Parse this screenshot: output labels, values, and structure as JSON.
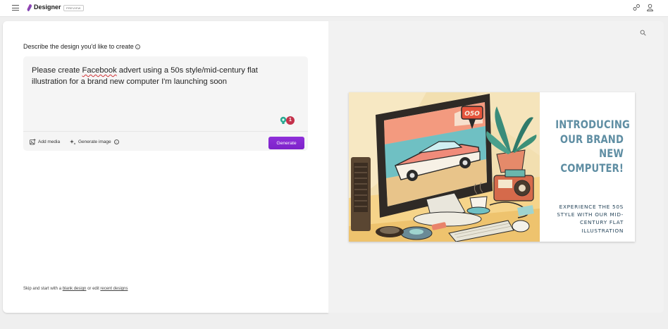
{
  "app": {
    "title": "Designer",
    "badge": "PREVIEW"
  },
  "left": {
    "heading": "Describe the design you'd like to create",
    "prompt_before": "Please create ",
    "prompt_flagged_word": "Facebook",
    "prompt_after": " advert using a 50s style/mid-century flat illustration for a brand new computer I'm launching soon",
    "issue_count": "1",
    "add_media_label": "Add media",
    "generate_image_label": "Generate image",
    "generate_button": "Generate",
    "footer": {
      "prefix": "Skip and start with a ",
      "blank_link": "blank design",
      "middle": " or edit ",
      "recent_link": "recent designs"
    }
  },
  "preview": {
    "sign_text": "O5O",
    "headline": "INTRODUCING\nOUR BRAND\nNEW\nCOMPUTER!",
    "subline": "EXPERIENCE THE 50S\nSTYLE WITH OUR MID-\nCENTURY FLAT\nILLUSTRATION"
  },
  "colors": {
    "accent": "#8a2be2",
    "headline": "#5f8ea3",
    "subline": "#1f3f55",
    "badge": "#c4314b"
  },
  "icons": [
    "hamburger-icon",
    "designer-logo-icon",
    "share-icon",
    "profile-icon",
    "info-icon",
    "lightbulb-icon",
    "add-media-icon",
    "sparkle-icon",
    "zoom-icon"
  ]
}
